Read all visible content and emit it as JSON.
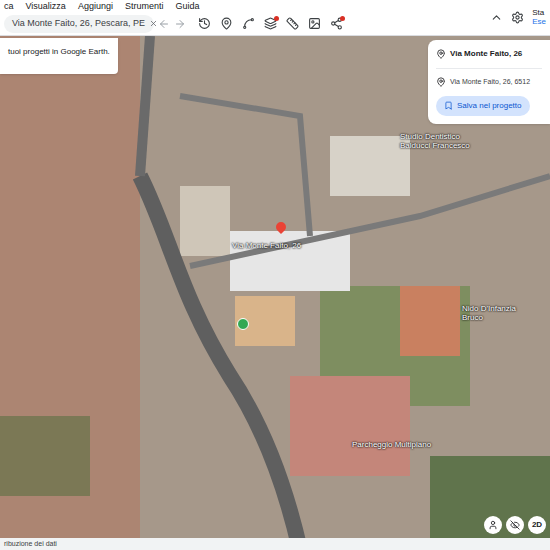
{
  "menu": [
    "ca",
    "Visualizza",
    "Aggiungi",
    "Strumenti",
    "Guida"
  ],
  "search": {
    "value": "Via Monte Faito, 26, Pescara, PE"
  },
  "toolbar": [
    {
      "kind": "history",
      "badge": false
    },
    {
      "kind": "pin",
      "badge": false
    },
    {
      "kind": "path",
      "badge": false
    },
    {
      "kind": "layers",
      "badge": true
    },
    {
      "kind": "ruler",
      "badge": false
    },
    {
      "kind": "photo",
      "badge": false
    },
    {
      "kind": "share",
      "badge": true
    }
  ],
  "account": {
    "line1": "Sta",
    "line2": "Ese"
  },
  "tip": "tuoi progetti in Google Earth.",
  "place_card": {
    "title": "Via Monte Faito, 26",
    "address": "Via Monte Faito, 26, 6512",
    "button": "Salva nel progetto"
  },
  "map_labels": [
    {
      "text": "Via Monte Faito, 26"
    },
    {
      "text": "Studio Dentistico Balducci Francesco"
    },
    {
      "text": "Nido D'Infanzia Bruco"
    },
    {
      "text": "Parcheggio Multipiano"
    }
  ],
  "attribution": "ribuzione dei dati",
  "view_toggle": "2D"
}
